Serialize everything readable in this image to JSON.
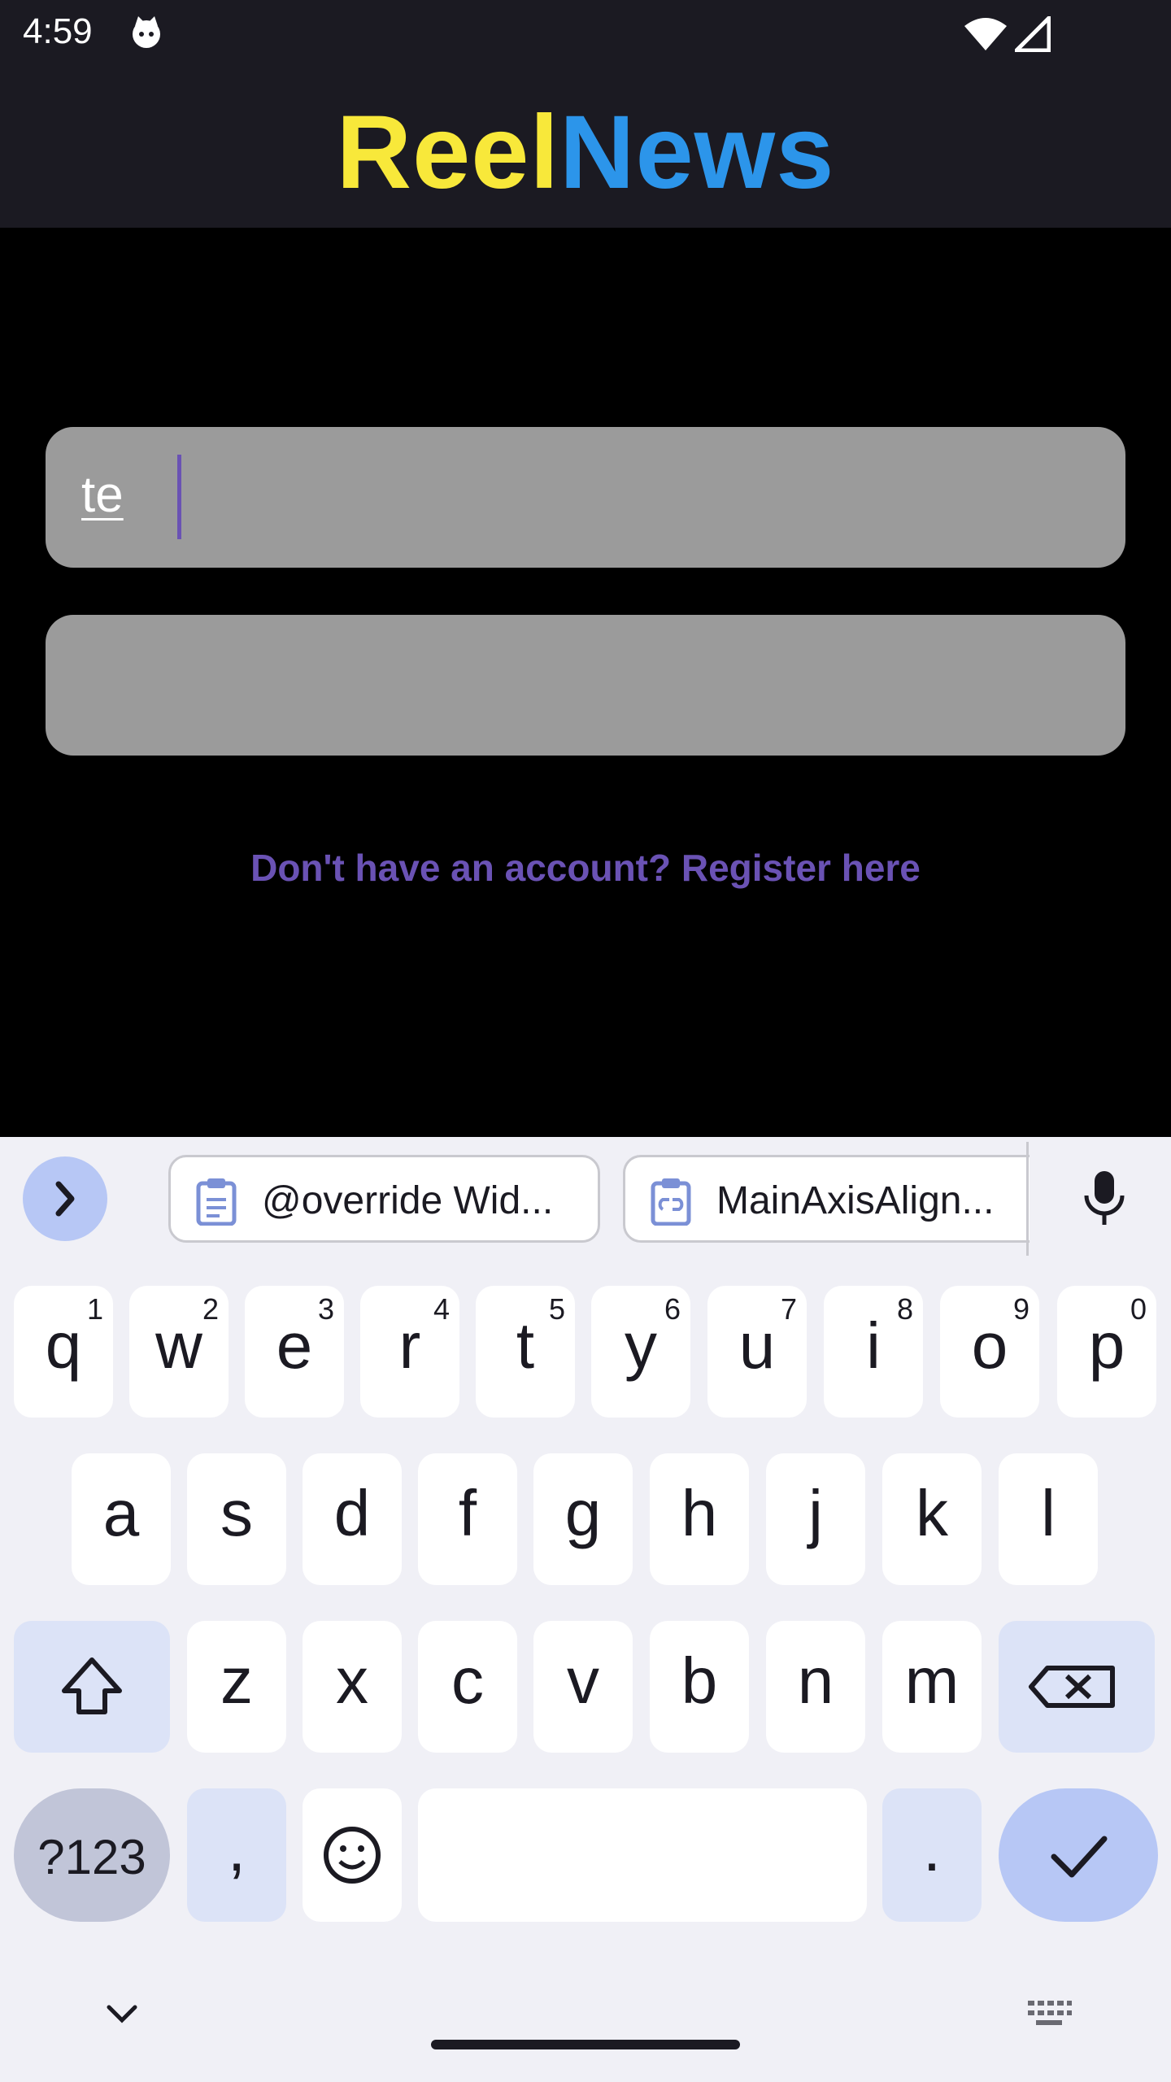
{
  "status_bar": {
    "time": "4:59",
    "icons": [
      "cat-face-icon",
      "wifi-icon",
      "signal-icon"
    ]
  },
  "app": {
    "title_part1": "Reel",
    "title_part2": "News",
    "title_colors": {
      "part1": "#f8e83a",
      "part2": "#2c95ea"
    }
  },
  "form": {
    "email_value": "te",
    "password_value": "",
    "register_link": "Don't have an account? Register here",
    "accent_color": "#6a52b4"
  },
  "keyboard": {
    "suggestions": [
      "@override Wid...",
      "MainAxisAlign..."
    ],
    "row1": [
      {
        "k": "q",
        "n": "1"
      },
      {
        "k": "w",
        "n": "2"
      },
      {
        "k": "e",
        "n": "3"
      },
      {
        "k": "r",
        "n": "4"
      },
      {
        "k": "t",
        "n": "5"
      },
      {
        "k": "y",
        "n": "6"
      },
      {
        "k": "u",
        "n": "7"
      },
      {
        "k": "i",
        "n": "8"
      },
      {
        "k": "o",
        "n": "9"
      },
      {
        "k": "p",
        "n": "0"
      }
    ],
    "row2": [
      "a",
      "s",
      "d",
      "f",
      "g",
      "h",
      "j",
      "k",
      "l"
    ],
    "row3": [
      "z",
      "x",
      "c",
      "v",
      "b",
      "n",
      "m"
    ],
    "symbols_label": "?123",
    "comma_label": ",",
    "period_label": "."
  }
}
